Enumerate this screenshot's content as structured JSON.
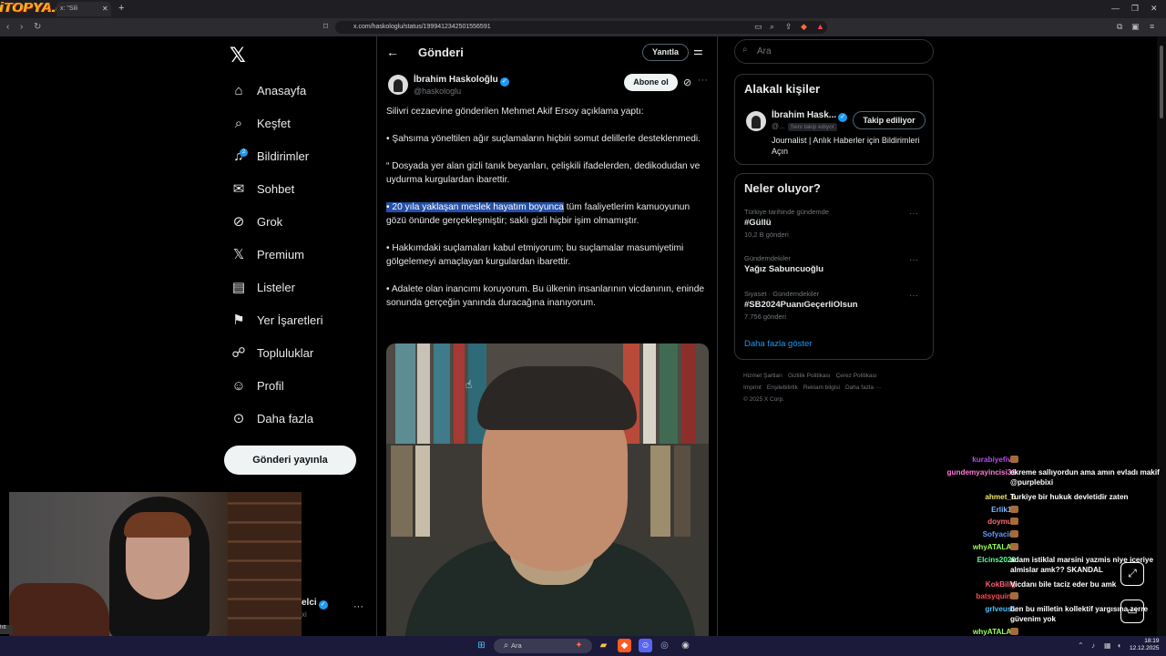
{
  "browser": {
    "site_logo": "iTOPYA.com",
    "tab_title": "x: \"Sili",
    "url": "x.com/haskologlu/status/1999412342501556591"
  },
  "nav": {
    "items": [
      {
        "icon": "home-icon",
        "label": "Anasayfa"
      },
      {
        "icon": "search-icon",
        "label": "Keşfet"
      },
      {
        "icon": "bell-icon",
        "label": "Bildirimler",
        "badge": "2"
      },
      {
        "icon": "mail-icon",
        "label": "Sohbet"
      },
      {
        "icon": "grok-icon",
        "label": "Grok"
      },
      {
        "icon": "x-icon",
        "label": "Premium"
      },
      {
        "icon": "list-icon",
        "label": "Listeler"
      },
      {
        "icon": "bookmark-icon",
        "label": "Yer İşaretleri"
      },
      {
        "icon": "communities-icon",
        "label": "Topluluklar"
      },
      {
        "icon": "person-icon",
        "label": "Profil"
      },
      {
        "icon": "more-circle-icon",
        "label": "Daha fazla"
      }
    ],
    "post_button": "Gönderi yayınla",
    "account_name": "elci",
    "account_handle": "xi"
  },
  "post": {
    "header_title": "Gönderi",
    "reply_button": "Yanıtla",
    "author_name": "İbrahim Haskoloğlu",
    "author_handle": "@haskologlu",
    "subscribe_button": "Abone ol",
    "paragraphs": [
      "Silivri cezaevine gönderilen Mehmet Akif Ersoy açıklama yaptı:",
      "• Şahsıma yöneltilen ağır suçlamaların hiçbiri somut delillerle desteklenmedi.",
      "“ Dosyada yer alan gizli tanık beyanları, çelişkili ifadelerden, dedikodudan ve uydurma kurgulardan ibarettir."
    ],
    "highlighted_text": "• 20 yıla yaklaşan meslek hayatım boyunca",
    "highlight_rest": " tüm faaliyetlerim kamuoyunun gözü önünde gerçekleşmiştir; saklı gizli hiçbir işim olmamıştır.",
    "paragraphs_after": [
      "• Hakkımdaki suçlamaları kabul etmiyorum; bu suçlamalar masumiyetimi gölgelemeyi amaçlayan kurgulardan ibarettir.",
      "• Adalete olan inancımı koruyorum. Bu ülkenin insanlarının vicdanının, eninde sonunda gerçeğin yanında duracağına inanıyorum."
    ]
  },
  "sidebar": {
    "search_placeholder": "Ara",
    "related_title": "Alakalı kişiler",
    "related": {
      "name": "İbrahim Hask...",
      "handle": "@...",
      "follows_you": "Seni takip ediyor",
      "follow_button": "Takip ediliyor",
      "bio": "Journalist | Anlık Haberler için Bildirimleri Açın"
    },
    "trends_title": "Neler oluyor?",
    "trends": [
      {
        "context": "Türkiye tarihinde gündemde",
        "name": "#Güllü",
        "count": "10,2 B gönderi"
      },
      {
        "context": "Gündemdekiler",
        "name": "Yağız Sabuncuoğlu",
        "count": ""
      },
      {
        "context": "Siyaset · Gündemdekiler",
        "name": "#SB2024PuanıGeçerliOlsun",
        "count": "7.756 gönderi"
      }
    ],
    "show_more": "Daha fazla göster",
    "footer": [
      "Hizmet Şartları",
      "Gizlilik Politikası",
      "Çerez Politikası",
      "Imprint",
      "Erişilebilirlik",
      "Reklam bilgisi",
      "Daha fazla ···",
      "© 2025 X Corp."
    ]
  },
  "chat": {
    "lines": [
      {
        "user": "kurabiyefive",
        "color": "#b44cf0",
        "msg": ""
      },
      {
        "user": "gundemyayincisi31",
        "color": "#ff7ad9",
        "msg": "ekreme sallıyordun ama amın evladı makif @purplebixi"
      },
      {
        "user": "ahmet_b",
        "color": "#f5e66b",
        "msg": "Turkiye bir hukuk devletidir zaten"
      },
      {
        "user": "Erlik16",
        "color": "#7eb8ff",
        "msg": ""
      },
      {
        "user": "doymuz",
        "color": "#ff6b6b",
        "msg": ""
      },
      {
        "user": "Sofyacim",
        "color": "#5c9cff",
        "msg": ""
      },
      {
        "user": "whyATALAY",
        "color": "#9cff5c",
        "msg": ""
      },
      {
        "user": "Elcins2020",
        "color": "#5cff9c",
        "msg": "adam istiklal marsini yazmis niye iceriye almislar amk?? SKANDAL"
      },
      {
        "user": "KokBilig",
        "color": "#ff5c7a",
        "msg": "Vicdanı bile taciz eder bu amk"
      },
      {
        "user": "batsyquinn",
        "color": "#ff4c4c",
        "msg": ""
      },
      {
        "user": "grlveus1",
        "color": "#4cc2ff",
        "msg": "ben bu milletin kollektif yargısına zerre güvenim yok"
      },
      {
        "user": "whyATALAY",
        "color": "#9cff5c",
        "msg": ""
      }
    ]
  },
  "taskbar": {
    "search_placeholder": "Ara",
    "clock_time": "18:19",
    "clock_date": "12.12.2025"
  },
  "colors": {
    "accent": "#1d9bf0",
    "highlight": "#2550a8",
    "background": "#000000",
    "border": "#2f3336"
  }
}
